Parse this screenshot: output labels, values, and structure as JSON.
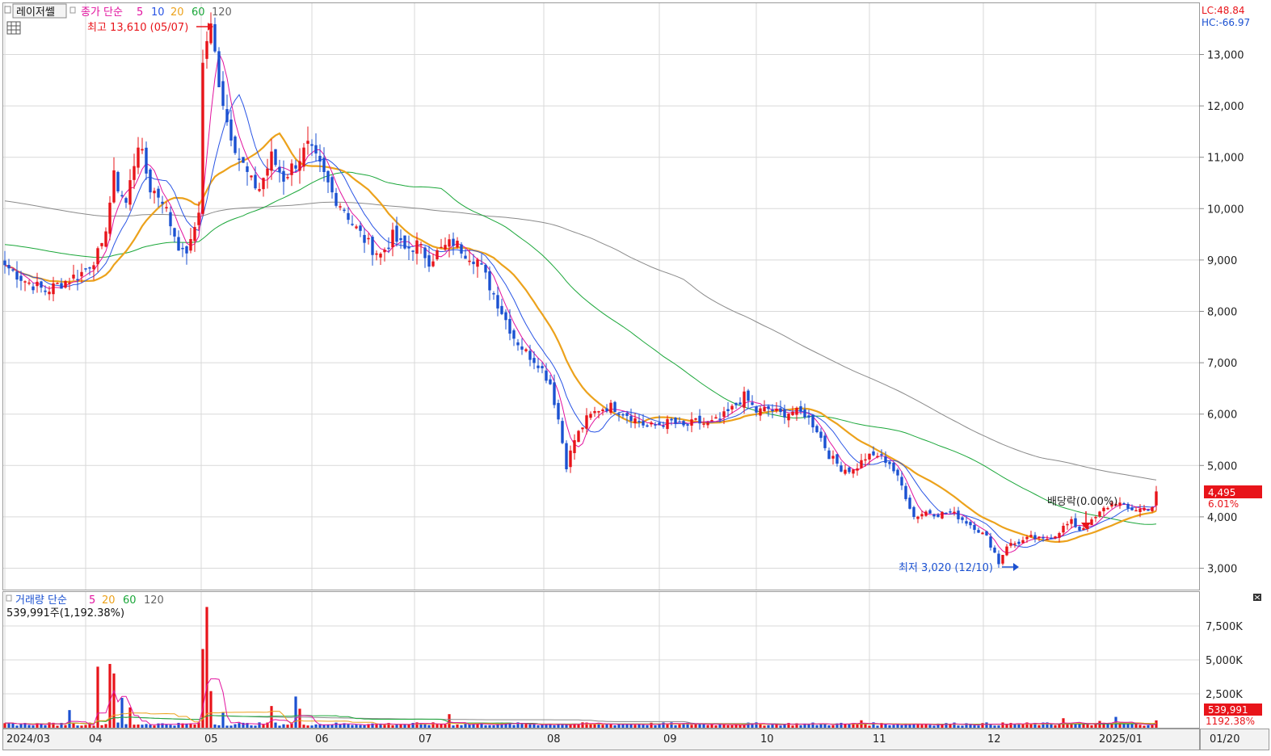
{
  "header": {
    "stock_name": "레이저쎌",
    "price_legend_prefix": "종가 단순",
    "volume_legend_prefix": "거래량 단순",
    "ma_labels": [
      "5",
      "10",
      "20",
      "60",
      "120"
    ],
    "volume_ma_labels": [
      "5",
      "20",
      "60",
      "120"
    ],
    "lc": "LC:48.84",
    "hc": "HC:-66.97",
    "volume_summary": "539,991주(1,192.38%)"
  },
  "annotations": {
    "high": "최고 13,610 (05/07)",
    "low": "최저 3,020 (12/10)",
    "dividend": "배당락(0.00%)"
  },
  "price_box": {
    "current": "4,495",
    "change": "6.01%"
  },
  "volume_box": {
    "current": "539,991",
    "ratio": "1192.38%"
  },
  "colors": {
    "up": "#e8141a",
    "down": "#1b51d1",
    "ma5": "#e2139f",
    "ma10": "#2a55e5",
    "ma20": "#eca21c",
    "ma60": "#1ba73a",
    "ma120": "#8a8a8a",
    "grid": "#d9d9d9"
  },
  "chart_data": [
    {
      "type": "candlestick",
      "title": "레이저쎌",
      "y_ticks": [
        "3,000",
        "4,000",
        "5,000",
        "6,000",
        "7,000",
        "8,000",
        "9,000",
        "10,000",
        "11,000",
        "12,000",
        "13,000"
      ],
      "y_tick_values": [
        3000,
        4000,
        5000,
        6000,
        7000,
        8000,
        9000,
        10000,
        11000,
        12000,
        13000
      ],
      "ylim": [
        2700,
        14200
      ],
      "x_tick_labels": [
        "2024/03",
        "04",
        "05",
        "06",
        "07",
        "08",
        "09",
        "10",
        "11",
        "12",
        "2025/01",
        "01/20"
      ],
      "anchors": [
        {
          "d": 0,
          "c": 8900
        },
        {
          "d": 5,
          "c": 8600
        },
        {
          "d": 10,
          "c": 8400
        },
        {
          "d": 14,
          "c": 8550
        },
        {
          "d": 19,
          "c": 8750
        },
        {
          "d": 24,
          "c": 9200
        },
        {
          "d": 27,
          "c": 10600
        },
        {
          "d": 30,
          "c": 10100
        },
        {
          "d": 33,
          "c": 11300
        },
        {
          "d": 36,
          "c": 10400
        },
        {
          "d": 39,
          "c": 10200
        },
        {
          "d": 41,
          "c": 9700
        },
        {
          "d": 44,
          "c": 9100
        },
        {
          "d": 46,
          "c": 9300
        },
        {
          "d": 48,
          "c": 10000
        },
        {
          "d": 49,
          "c": 12800
        },
        {
          "d": 50,
          "c": 13300
        },
        {
          "d": 51,
          "c": 13500
        },
        {
          "d": 53,
          "c": 12500
        },
        {
          "d": 55,
          "c": 11700
        },
        {
          "d": 58,
          "c": 11000
        },
        {
          "d": 61,
          "c": 10500
        },
        {
          "d": 63,
          "c": 10400
        },
        {
          "d": 66,
          "c": 11000
        },
        {
          "d": 69,
          "c": 10600
        },
        {
          "d": 72,
          "c": 10900
        },
        {
          "d": 75,
          "c": 11200
        },
        {
          "d": 78,
          "c": 10800
        },
        {
          "d": 81,
          "c": 10300
        },
        {
          "d": 84,
          "c": 10000
        },
        {
          "d": 87,
          "c": 9600
        },
        {
          "d": 90,
          "c": 9300
        },
        {
          "d": 93,
          "c": 9100
        },
        {
          "d": 96,
          "c": 9450
        },
        {
          "d": 99,
          "c": 9200
        },
        {
          "d": 102,
          "c": 9300
        },
        {
          "d": 105,
          "c": 9000
        },
        {
          "d": 108,
          "c": 9200
        },
        {
          "d": 111,
          "c": 9350
        },
        {
          "d": 114,
          "c": 9150
        },
        {
          "d": 117,
          "c": 9000
        },
        {
          "d": 120,
          "c": 8500
        },
        {
          "d": 123,
          "c": 8000
        },
        {
          "d": 126,
          "c": 7500
        },
        {
          "d": 129,
          "c": 7200
        },
        {
          "d": 132,
          "c": 7000
        },
        {
          "d": 135,
          "c": 6600
        },
        {
          "d": 137,
          "c": 5900
        },
        {
          "d": 139,
          "c": 5000
        },
        {
          "d": 141,
          "c": 5500
        },
        {
          "d": 144,
          "c": 5900
        },
        {
          "d": 147,
          "c": 6100
        },
        {
          "d": 150,
          "c": 6150
        },
        {
          "d": 153,
          "c": 6050
        },
        {
          "d": 156,
          "c": 5900
        },
        {
          "d": 159,
          "c": 5750
        },
        {
          "d": 162,
          "c": 5800
        },
        {
          "d": 165,
          "c": 5850
        },
        {
          "d": 168,
          "c": 5750
        },
        {
          "d": 171,
          "c": 5850
        },
        {
          "d": 174,
          "c": 5800
        },
        {
          "d": 177,
          "c": 5900
        },
        {
          "d": 180,
          "c": 6100
        },
        {
          "d": 183,
          "c": 6350
        },
        {
          "d": 186,
          "c": 6050
        },
        {
          "d": 189,
          "c": 6100
        },
        {
          "d": 192,
          "c": 6000
        },
        {
          "d": 195,
          "c": 6050
        },
        {
          "d": 198,
          "c": 6000
        },
        {
          "d": 201,
          "c": 5700
        },
        {
          "d": 204,
          "c": 5200
        },
        {
          "d": 207,
          "c": 4950
        },
        {
          "d": 210,
          "c": 4900
        },
        {
          "d": 213,
          "c": 5150
        },
        {
          "d": 216,
          "c": 5200
        },
        {
          "d": 219,
          "c": 5050
        },
        {
          "d": 222,
          "c": 4600
        },
        {
          "d": 225,
          "c": 4000
        },
        {
          "d": 228,
          "c": 4100
        },
        {
          "d": 231,
          "c": 4050
        },
        {
          "d": 234,
          "c": 4100
        },
        {
          "d": 237,
          "c": 3950
        },
        {
          "d": 240,
          "c": 3800
        },
        {
          "d": 243,
          "c": 3600
        },
        {
          "d": 245,
          "c": 3300
        },
        {
          "d": 246,
          "c": 3100
        },
        {
          "d": 248,
          "c": 3450
        },
        {
          "d": 251,
          "c": 3500
        },
        {
          "d": 254,
          "c": 3600
        },
        {
          "d": 257,
          "c": 3550
        },
        {
          "d": 260,
          "c": 3650
        },
        {
          "d": 262,
          "c": 3800
        },
        {
          "d": 264,
          "c": 3900
        },
        {
          "d": 266,
          "c": 3750
        },
        {
          "d": 269,
          "c": 3900
        },
        {
          "d": 272,
          "c": 4150
        },
        {
          "d": 275,
          "c": 4300
        },
        {
          "d": 278,
          "c": 4150
        },
        {
          "d": 281,
          "c": 4150
        },
        {
          "d": 284,
          "c": 4200
        },
        {
          "d": 285,
          "c": 4495
        }
      ],
      "ma_start": {
        "ma60": 9300,
        "ma120": 10150
      },
      "volume_ylim": [
        0,
        10000
      ],
      "volume_y_ticks": [
        "2,500K",
        "5,000K",
        "7,500K"
      ],
      "volume_y_tick_values": [
        2500,
        5000,
        7500
      ],
      "volume_spikes": [
        {
          "d": 16,
          "v": 1300
        },
        {
          "d": 23,
          "v": 4500
        },
        {
          "d": 26,
          "v": 4700
        },
        {
          "d": 27,
          "v": 4000
        },
        {
          "d": 29,
          "v": 2200
        },
        {
          "d": 31,
          "v": 1500
        },
        {
          "d": 49,
          "v": 5800
        },
        {
          "d": 50,
          "v": 8900
        },
        {
          "d": 51,
          "v": 2700
        },
        {
          "d": 54,
          "v": 1100
        },
        {
          "d": 66,
          "v": 1600
        },
        {
          "d": 72,
          "v": 2300
        },
        {
          "d": 73,
          "v": 1400
        },
        {
          "d": 110,
          "v": 1000
        },
        {
          "d": 212,
          "v": 550
        },
        {
          "d": 262,
          "v": 700
        },
        {
          "d": 271,
          "v": 500
        },
        {
          "d": 275,
          "v": 800
        },
        {
          "d": 285,
          "v": 540
        }
      ]
    }
  ]
}
